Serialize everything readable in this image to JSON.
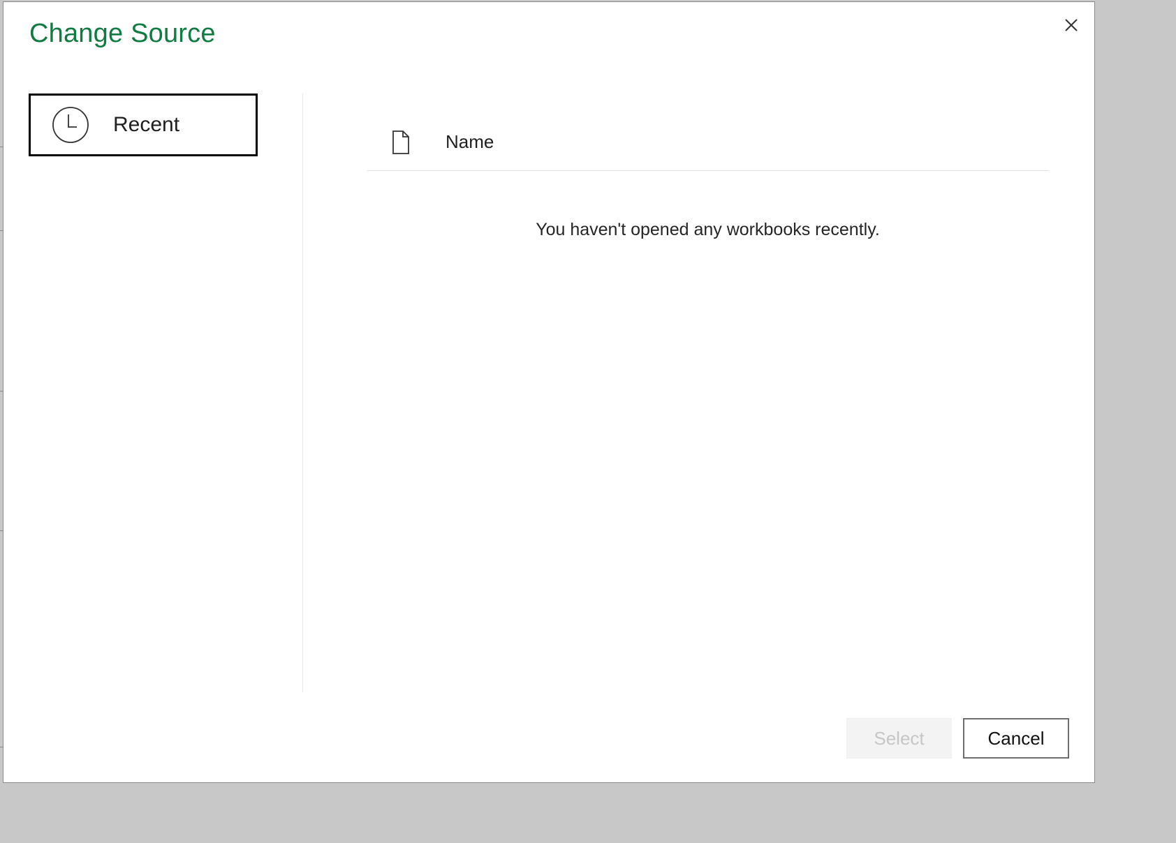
{
  "dialog": {
    "title": "Change Source",
    "close_icon": "close-icon"
  },
  "nav": {
    "items": [
      {
        "label": "Recent",
        "icon": "clock-icon",
        "selected": true
      }
    ]
  },
  "list": {
    "header": {
      "icon": "file-icon",
      "name_column": "Name"
    },
    "empty_message": "You haven't opened any workbooks recently."
  },
  "footer": {
    "select_label": "Select",
    "select_disabled": true,
    "cancel_label": "Cancel"
  },
  "colors": {
    "title": "#107c41",
    "border": "#000000",
    "disabled_text": "#c6c6c6"
  }
}
